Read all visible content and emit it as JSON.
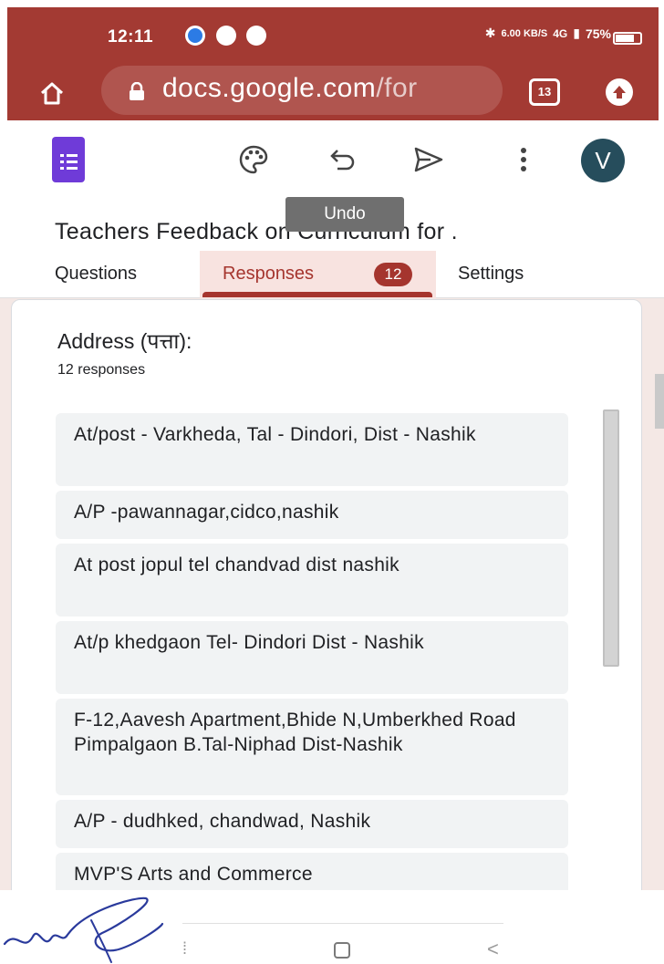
{
  "status_bar": {
    "time": "12:11",
    "net_speed": "6.00 KB/S",
    "signal_label": "4G",
    "battery": "75%"
  },
  "browser": {
    "url_main": "docs.google.com",
    "url_rest": "/for",
    "tab_count": "13"
  },
  "forms_toolbar": {
    "tooltip": "Undo",
    "avatar_letter": "V"
  },
  "form": {
    "title": "Teachers Feedback on Curriculum for ."
  },
  "tabs": {
    "questions": "Questions",
    "responses": "Responses",
    "responses_count": "12",
    "settings": "Settings"
  },
  "question": {
    "title": "Address (पत्ता):",
    "response_count": "12 responses"
  },
  "responses": [
    "At/post - Varkheda, Tal - Dindori, Dist - Nashik",
    "A/P -pawannagar,cidco,nashik",
    "At post jopul tel chandvad dist nashik",
    "At/p khedgaon Tel- Dindori Dist - Nashik",
    "F-12,Aavesh Apartment,Bhide N,Umberkhed Road Pimpalgaon B.Tal-Niphad Dist-Nashik",
    "A/P - dudhked, chandwad, Nashik",
    "MVP'S Arts and Commerce"
  ],
  "colors": {
    "browser_bar": "#a33a33",
    "accent": "#a5352e",
    "forms_purple": "#6f3bd8"
  }
}
